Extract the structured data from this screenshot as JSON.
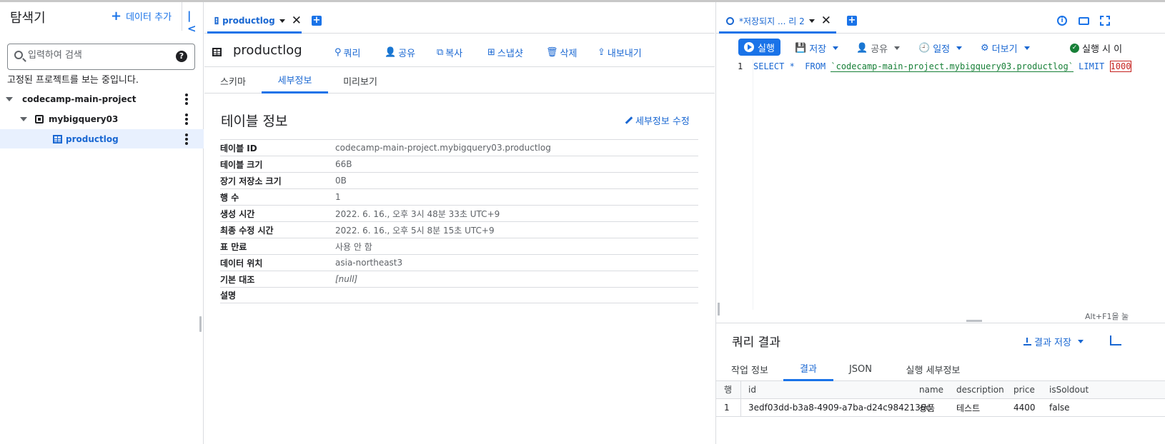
{
  "explorer": {
    "title": "탐색기",
    "add_data_label": "데이터 추가",
    "search_placeholder": "입력하여 검색",
    "pinned_message": "고정된 프로젝트를 보는 중입니다.",
    "tree": {
      "project": "codecamp-main-project",
      "dataset": "mybigquery03",
      "table": "productlog"
    }
  },
  "middle": {
    "tab_label": "productlog",
    "object_title": "productlog",
    "actions": [
      "쿼리",
      "공유",
      "복사",
      "스냅샷",
      "삭제",
      "내보내기"
    ],
    "sub_tabs": [
      "스키마",
      "세부정보",
      "미리보기"
    ],
    "active_sub_tab": "세부정보",
    "info_title": "테이블 정보",
    "edit_details_label": "세부정보 수정",
    "details": [
      {
        "key": "테이블 ID",
        "value": "codecamp-main-project.mybigquery03.productlog"
      },
      {
        "key": "테이블 크기",
        "value": "66B"
      },
      {
        "key": "장기 저장소 크기",
        "value": "0B"
      },
      {
        "key": "행 수",
        "value": "1"
      },
      {
        "key": "생성 시간",
        "value": "2022. 6. 16., 오후 3시 48분 33초 UTC+9"
      },
      {
        "key": "최종 수정 시간",
        "value": "2022. 6. 16., 오후 5시 8분 15초 UTC+9"
      },
      {
        "key": "표 만료",
        "value": "사용 안 함"
      },
      {
        "key": "데이터 위치",
        "value": "asia-northeast3"
      },
      {
        "key": "기본 대조",
        "value": "[null]"
      },
      {
        "key": "설명",
        "value": ""
      }
    ]
  },
  "editor": {
    "tab_label": "*저장되지 ... 리 2",
    "toolbar": {
      "run": "실행",
      "save": "저장",
      "share": "공유",
      "schedule": "일정",
      "more": "더보기",
      "status": "실행 시 이"
    },
    "line_number": "1",
    "query": {
      "select": "SELECT *  FROM ",
      "table_ref": "`codecamp-main-project.mybigquery03.productlog`",
      "limit_kw": " LIMIT ",
      "limit_val": "1000"
    },
    "hint": "Alt+F1을 눌"
  },
  "results": {
    "title": "쿼리 결과",
    "save_results_label": "결과 저장",
    "tabs": [
      "작업 정보",
      "결과",
      "JSON",
      "실행 세부정보"
    ],
    "active_tab": "결과",
    "columns": [
      "행",
      "id",
      "name",
      "description",
      "price",
      "isSoldout"
    ],
    "rows": [
      [
        "1",
        "3edf03dd-b3a8-4909-a7ba-d24c9842136c",
        "상품",
        "테스트",
        "4400",
        "false"
      ]
    ]
  }
}
